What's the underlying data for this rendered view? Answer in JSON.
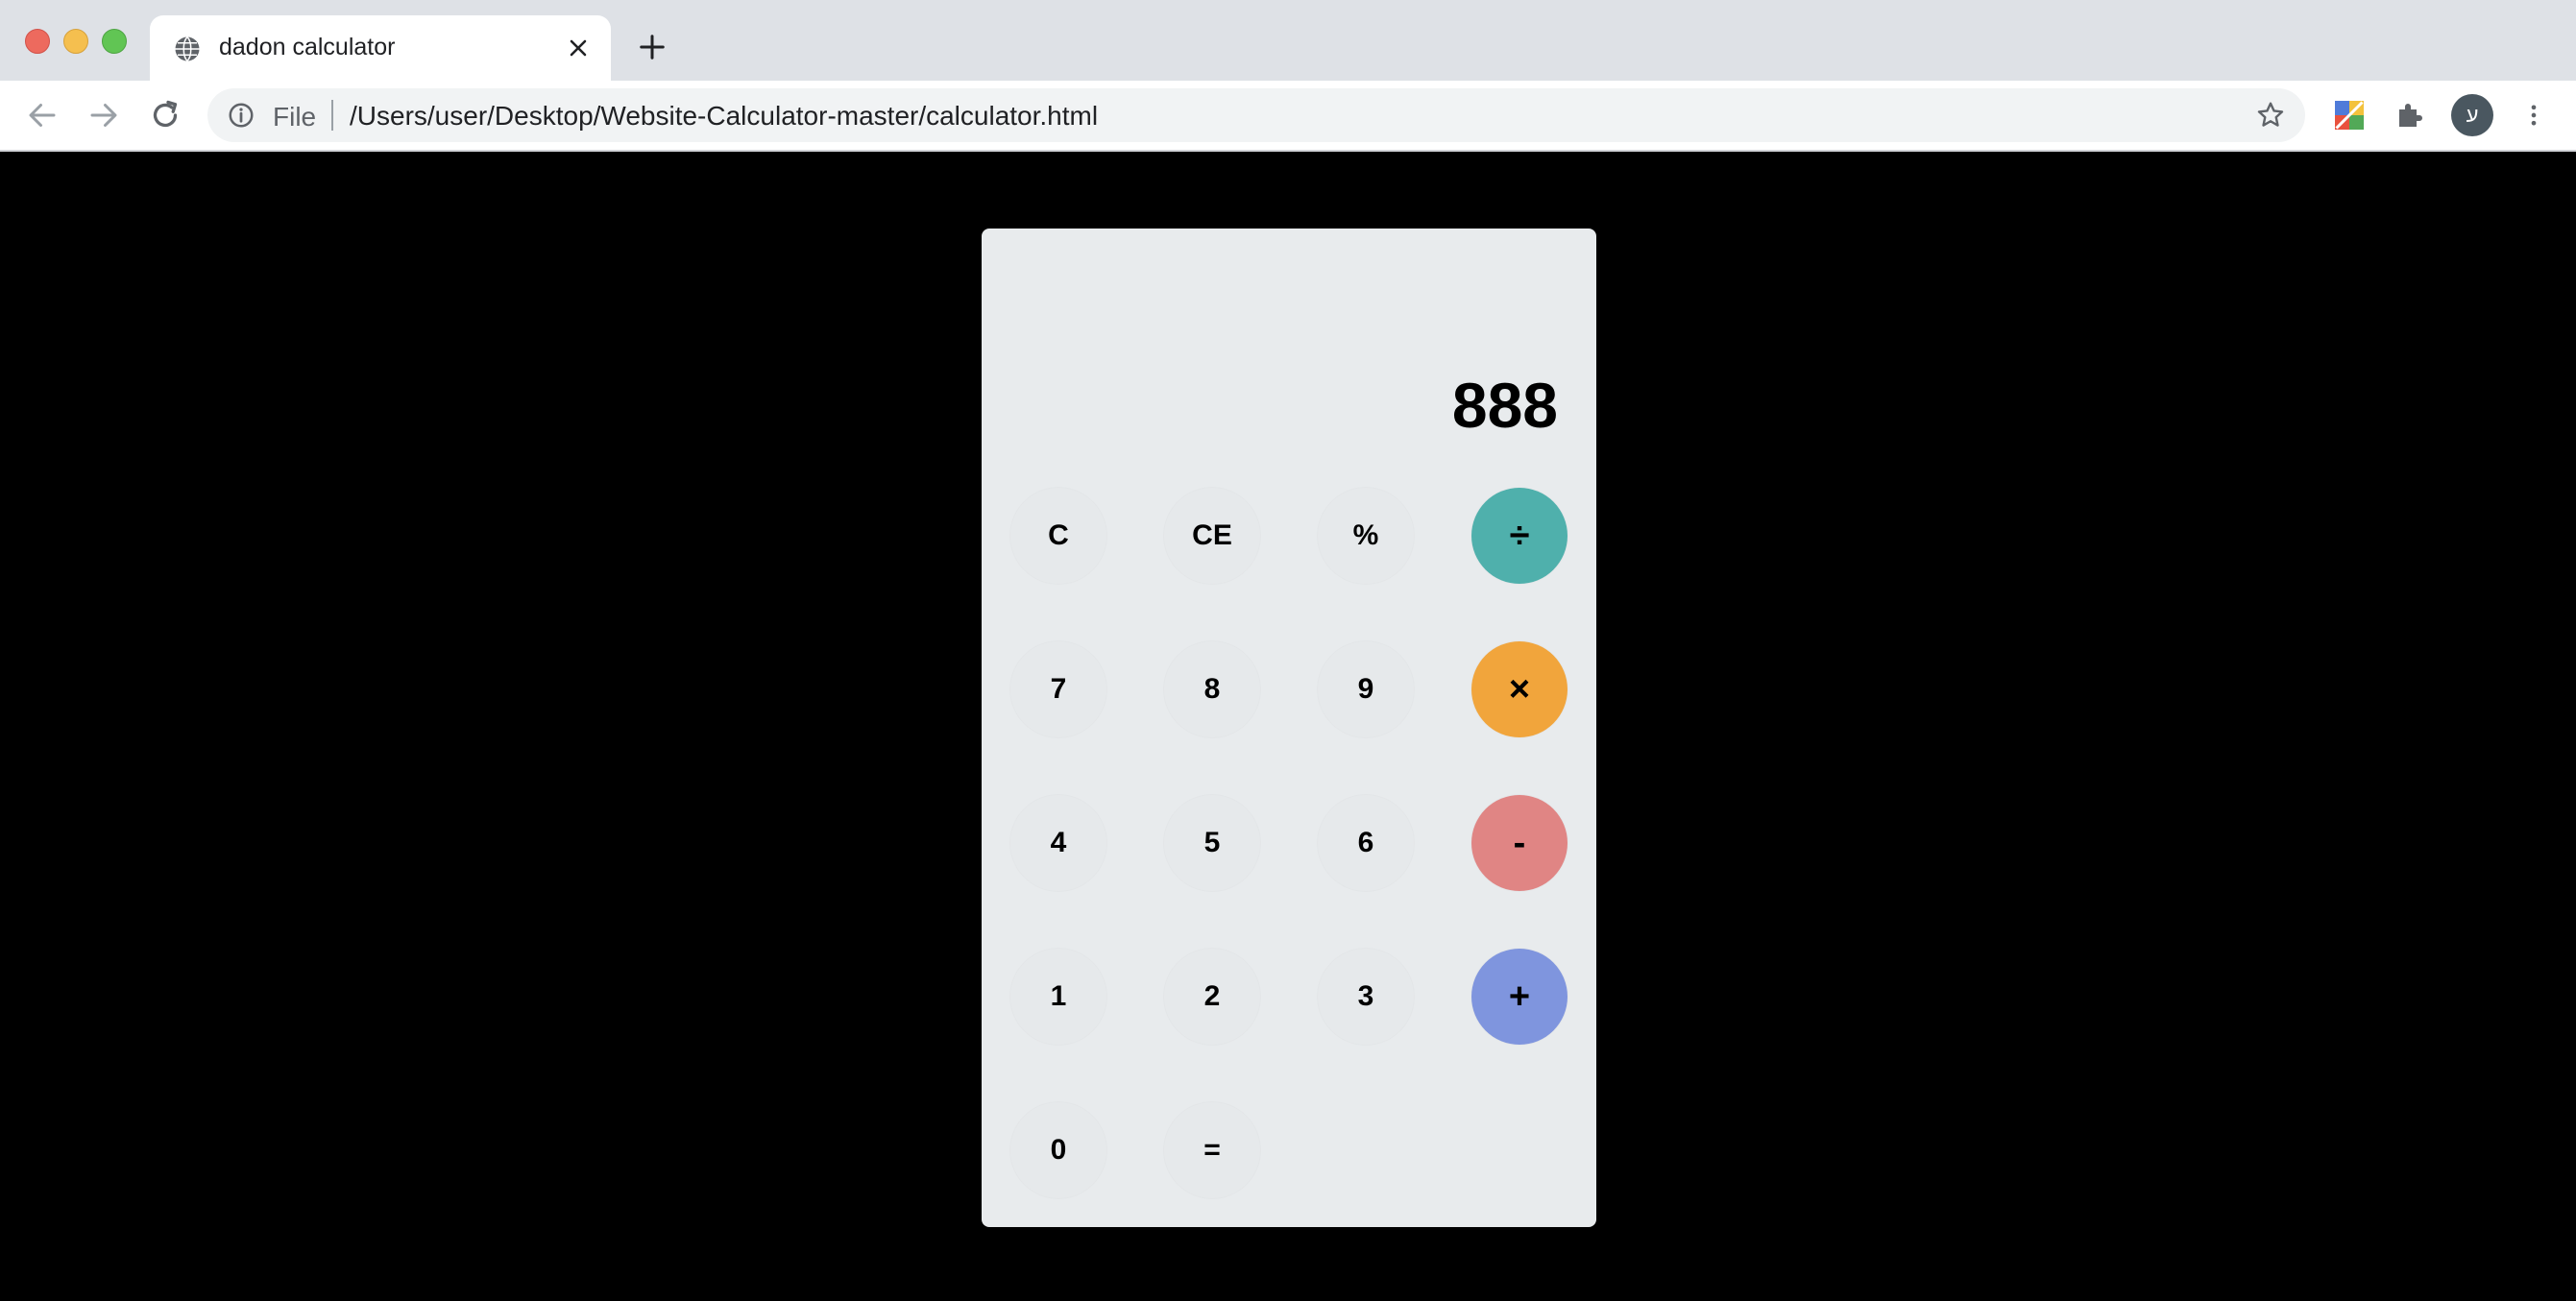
{
  "browser": {
    "tab_title": "dadon calculator",
    "url_scheme_label": "File",
    "url_path": "/Users/user/Desktop/Website-Calculator-master/calculator.html",
    "avatar_letter": "ע"
  },
  "calculator": {
    "display_value": "888",
    "rows": [
      [
        {
          "label": "C"
        },
        {
          "label": "CE"
        },
        {
          "label": "%"
        },
        {
          "label": "÷",
          "color": "#4fb0ac"
        }
      ],
      [
        {
          "label": "7"
        },
        {
          "label": "8"
        },
        {
          "label": "9"
        },
        {
          "label": "×",
          "color": "#f1a53c"
        }
      ],
      [
        {
          "label": "4"
        },
        {
          "label": "5"
        },
        {
          "label": "6"
        },
        {
          "label": "-",
          "color": "#e08584"
        }
      ],
      [
        {
          "label": "1"
        },
        {
          "label": "2"
        },
        {
          "label": "3"
        },
        {
          "label": "+",
          "color": "#7f95de"
        }
      ],
      [
        {
          "label": "0"
        },
        {
          "label": "="
        }
      ]
    ]
  },
  "colors": {
    "page_background": "#000000",
    "calculator_background": "#e8ebed",
    "divide_color": "#4fb0ac",
    "multiply_color": "#f1a53c",
    "subtract_color": "#e08584",
    "add_color": "#7f95de"
  }
}
